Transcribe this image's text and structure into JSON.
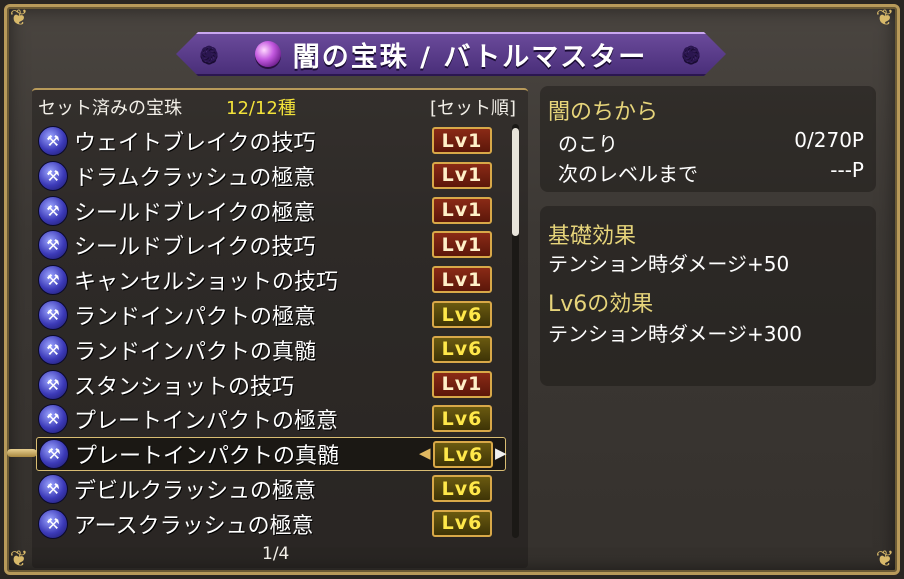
{
  "title": "闇の宝珠 / バトルマスター",
  "list": {
    "header_label": "セット済みの宝珠",
    "count": "12/12種",
    "sort_label": "[セット順]",
    "page": "1/4",
    "selected_index": 9,
    "items": [
      {
        "name": "ウェイトブレイクの技巧",
        "level": "Lv1"
      },
      {
        "name": "ドラムクラッシュの極意",
        "level": "Lv1"
      },
      {
        "name": "シールドブレイクの極意",
        "level": "Lv1"
      },
      {
        "name": "シールドブレイクの技巧",
        "level": "Lv1"
      },
      {
        "name": "キャンセルショットの技巧",
        "level": "Lv1"
      },
      {
        "name": "ランドインパクトの極意",
        "level": "Lv6"
      },
      {
        "name": "ランドインパクトの真髄",
        "level": "Lv6"
      },
      {
        "name": "スタンショットの技巧",
        "level": "Lv1"
      },
      {
        "name": "プレートインパクトの極意",
        "level": "Lv6"
      },
      {
        "name": "プレートインパクトの真髄",
        "level": "Lv6"
      },
      {
        "name": "デビルクラッシュの極意",
        "level": "Lv6"
      },
      {
        "name": "アースクラッシュの極意",
        "level": "Lv6"
      }
    ]
  },
  "power": {
    "title": "闇のちから",
    "remaining_label": "のこり",
    "remaining_value": "0/270P",
    "next_label": "次のレベルまで",
    "next_value": "---P"
  },
  "effects": {
    "base_title": "基礎効果",
    "base_text": "テンション時ダメージ+50",
    "lv_title": "Lv6の効果",
    "lv_text": "テンション時ダメージ+300"
  },
  "colors": {
    "accent_gold": "#e6d47a",
    "count_yellow": "#f2e23a",
    "banner_purple": "#5a3a8a"
  }
}
